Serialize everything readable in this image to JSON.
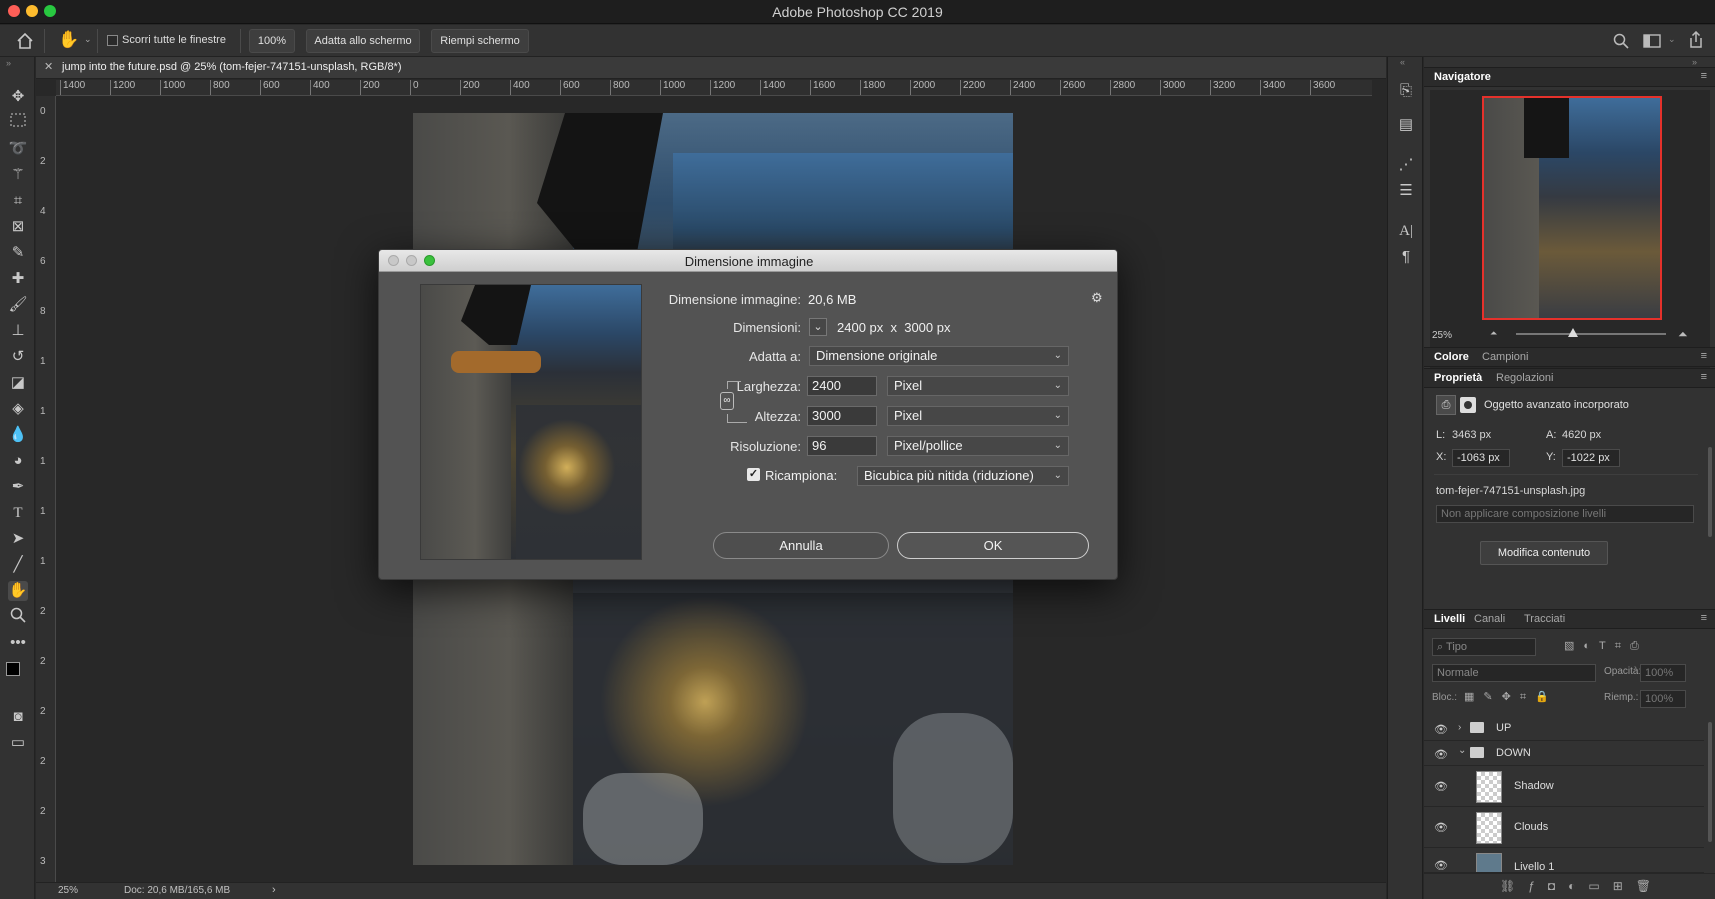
{
  "app": {
    "title": "Adobe Photoshop CC 2019"
  },
  "options_bar": {
    "scroll_all_label": "Scorri tutte le finestre",
    "zoom_value": "100%",
    "fit_screen_label": "Adatta allo schermo",
    "fill_screen_label": "Riempi schermo"
  },
  "document": {
    "tab_title": "jump into the future.psd @ 25% (tom-fejer-747151-unsplash, RGB/8*)",
    "ruler_h": [
      "1400",
      "1200",
      "1000",
      "800",
      "600",
      "400",
      "200",
      "0",
      "200",
      "400",
      "600",
      "800",
      "1000",
      "1200",
      "1400",
      "1600",
      "1800",
      "2000",
      "2200",
      "2400",
      "2600",
      "2800",
      "3000",
      "3200",
      "3400",
      "3600"
    ],
    "ruler_v": [
      "0",
      "2",
      "4",
      "6",
      "8",
      "1",
      "1",
      "1",
      "1",
      "1",
      "2",
      "2",
      "2",
      "2",
      "2",
      "3"
    ]
  },
  "status_bar": {
    "zoom": "25%",
    "doc_info": "Doc: 20,6 MB/165,6 MB",
    "arrow": "›"
  },
  "navigator": {
    "tab": "Navigatore",
    "zoom": "25%"
  },
  "color_panel": {
    "tabs": [
      "Colore",
      "Campioni"
    ]
  },
  "properties": {
    "tabs": [
      "Proprietà",
      "Regolazioni"
    ],
    "type_label": "Oggetto avanzato incorporato",
    "w_label": "L:",
    "w_value": "3463 px",
    "h_label": "A:",
    "h_value": "4620 px",
    "x_label": "X:",
    "x_value": "-1063 px",
    "y_label": "Y:",
    "y_value": "-1022 px",
    "filename": "tom-fejer-747151-unsplash.jpg",
    "comp_placeholder": "Non applicare composizione livelli",
    "edit_button": "Modifica contenuto"
  },
  "layers_panel": {
    "tabs": [
      "Livelli",
      "Canali",
      "Tracciati"
    ],
    "filter_placeholder": "Tipo",
    "blend_mode": "Normale",
    "opacity_label": "Opacità:",
    "opacity_value": "100%",
    "lock_label": "Bloc.:",
    "fill_label": "Riemp.:",
    "fill_value": "100%",
    "layers": [
      {
        "name": "UP",
        "kind": "group"
      },
      {
        "name": "DOWN",
        "kind": "group"
      },
      {
        "name": "Shadow",
        "kind": "layer"
      },
      {
        "name": "Clouds",
        "kind": "layer"
      },
      {
        "name": "Livello 1",
        "kind": "layer"
      }
    ]
  },
  "dialog": {
    "title": "Dimensione immagine",
    "image_size_label": "Dimensione immagine:",
    "image_size_value": "20,6 MB",
    "dimensions_label": "Dimensioni:",
    "dimensions_value": "2400 px  x  3000 px",
    "fit_label": "Adatta a:",
    "fit_value": "Dimensione originale",
    "width_label": "Larghezza:",
    "width_value": "2400",
    "width_unit": "Pixel",
    "height_label": "Altezza:",
    "height_value": "3000",
    "height_unit": "Pixel",
    "resolution_label": "Risoluzione:",
    "resolution_value": "96",
    "resolution_unit": "Pixel/pollice",
    "resample_label": "Ricampiona:",
    "resample_checked": true,
    "resample_value": "Bicubica più nitida (riduzione)",
    "cancel_label": "Annulla",
    "ok_label": "OK"
  },
  "colors": {
    "accent_green": "#3ac13d",
    "nav_frame": "#e5312b",
    "light_red": "#fe5f57",
    "light_yellow": "#febc2e",
    "light_green": "#28c840"
  }
}
